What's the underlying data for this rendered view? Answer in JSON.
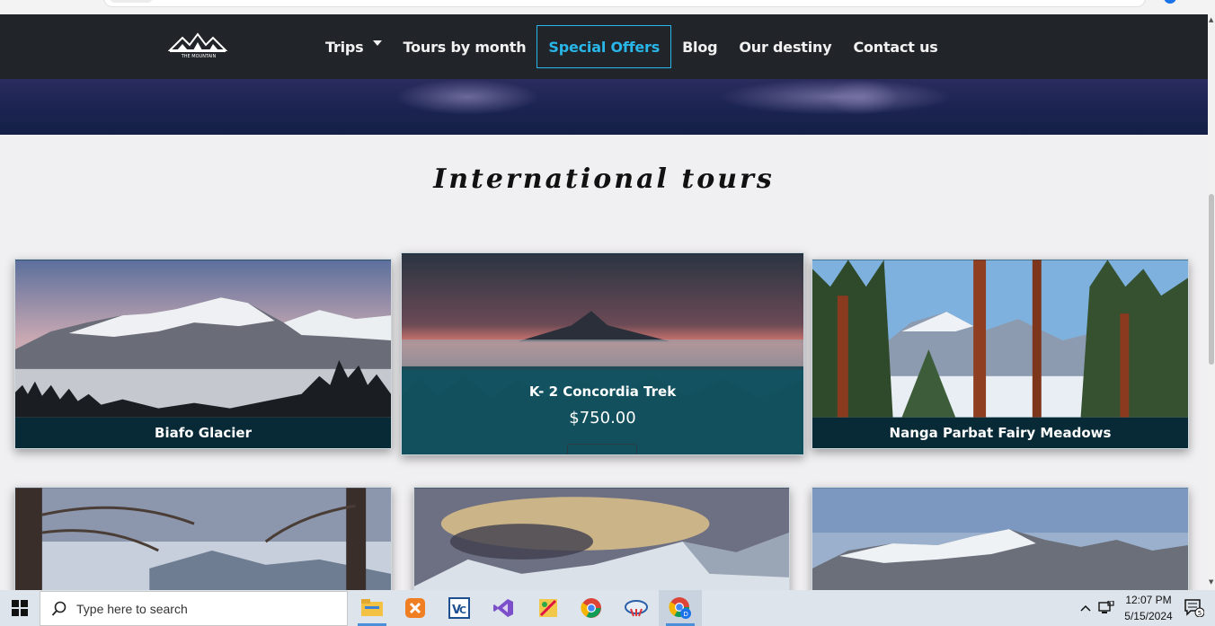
{
  "nav": {
    "logo_text": "THE MOUNTAIN",
    "items": [
      {
        "label": "Trips",
        "has_dropdown": true
      },
      {
        "label": "Tours by month"
      },
      {
        "label": "Special Offers",
        "active": true
      },
      {
        "label": "Blog"
      },
      {
        "label": "Our destiny"
      },
      {
        "label": "Contact us"
      }
    ],
    "active_color": "#29b6e8"
  },
  "section": {
    "title": "International tours"
  },
  "cards": [
    {
      "title": "Biafo Glacier"
    },
    {
      "title": "K- 2 Concordia Trek",
      "price": "$750.00",
      "hovered": true
    },
    {
      "title": "Nanga Parbat Fairy Meadows"
    }
  ],
  "taskbar": {
    "search_placeholder": "Type here to search",
    "time": "12:07 PM",
    "date": "5/15/2024",
    "notification_count": "5",
    "apps": [
      "file-explorer-icon",
      "xampp-icon",
      "vscode-icon",
      "visual-studio-icon",
      "paint-app-icon",
      "chrome-icon",
      "cloud-app-icon",
      "chrome-profile-icon"
    ]
  }
}
